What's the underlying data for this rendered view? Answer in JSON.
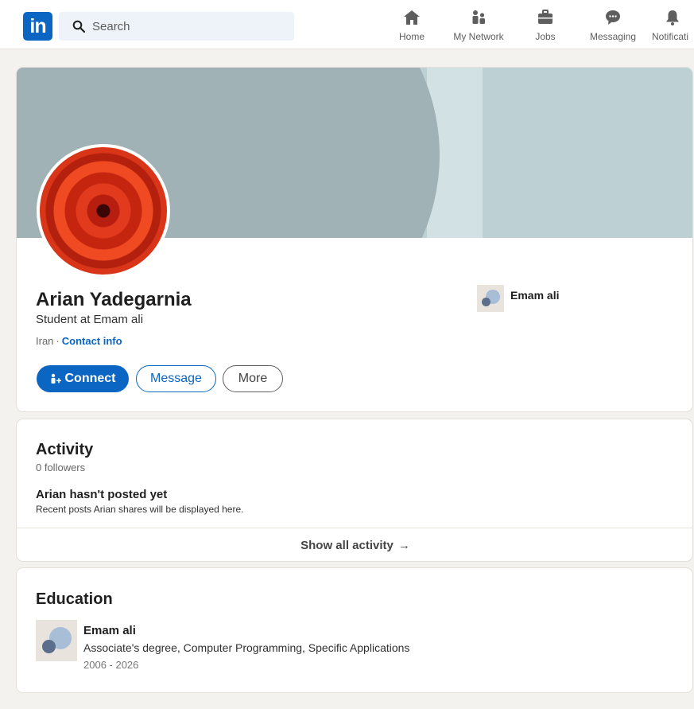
{
  "header": {
    "logo_text": "in",
    "search_placeholder": "Search",
    "nav": [
      {
        "label": "Home",
        "icon": "home-icon"
      },
      {
        "label": "My Network",
        "icon": "network-icon"
      },
      {
        "label": "Jobs",
        "icon": "briefcase-icon"
      },
      {
        "label": "Messaging",
        "icon": "messaging-icon"
      },
      {
        "label": "Notificati",
        "icon": "bell-icon"
      }
    ]
  },
  "profile": {
    "name": "Arian Yadegarnia",
    "headline": "Student at Emam ali",
    "location": "Iran",
    "separator": "·",
    "contact_label": "Contact info",
    "buttons": {
      "connect": "Connect",
      "message": "Message",
      "more": "More"
    },
    "organization": "Emam ali"
  },
  "activity": {
    "title": "Activity",
    "followers": "0 followers",
    "empty_title": "Arian hasn't posted yet",
    "empty_subtitle": "Recent posts Arian shares will be displayed here.",
    "show_all": "Show all activity",
    "arrow": "→"
  },
  "education": {
    "title": "Education",
    "school": "Emam ali",
    "degree": "Associate's degree, Computer Programming, Specific Applications",
    "years": "2006 - 2026"
  },
  "colors": {
    "brand": "#0a66c2",
    "banner_light": "#bdd1d5",
    "banner_dark": "#a0b2b6",
    "page_bg": "#f4f2ee"
  }
}
